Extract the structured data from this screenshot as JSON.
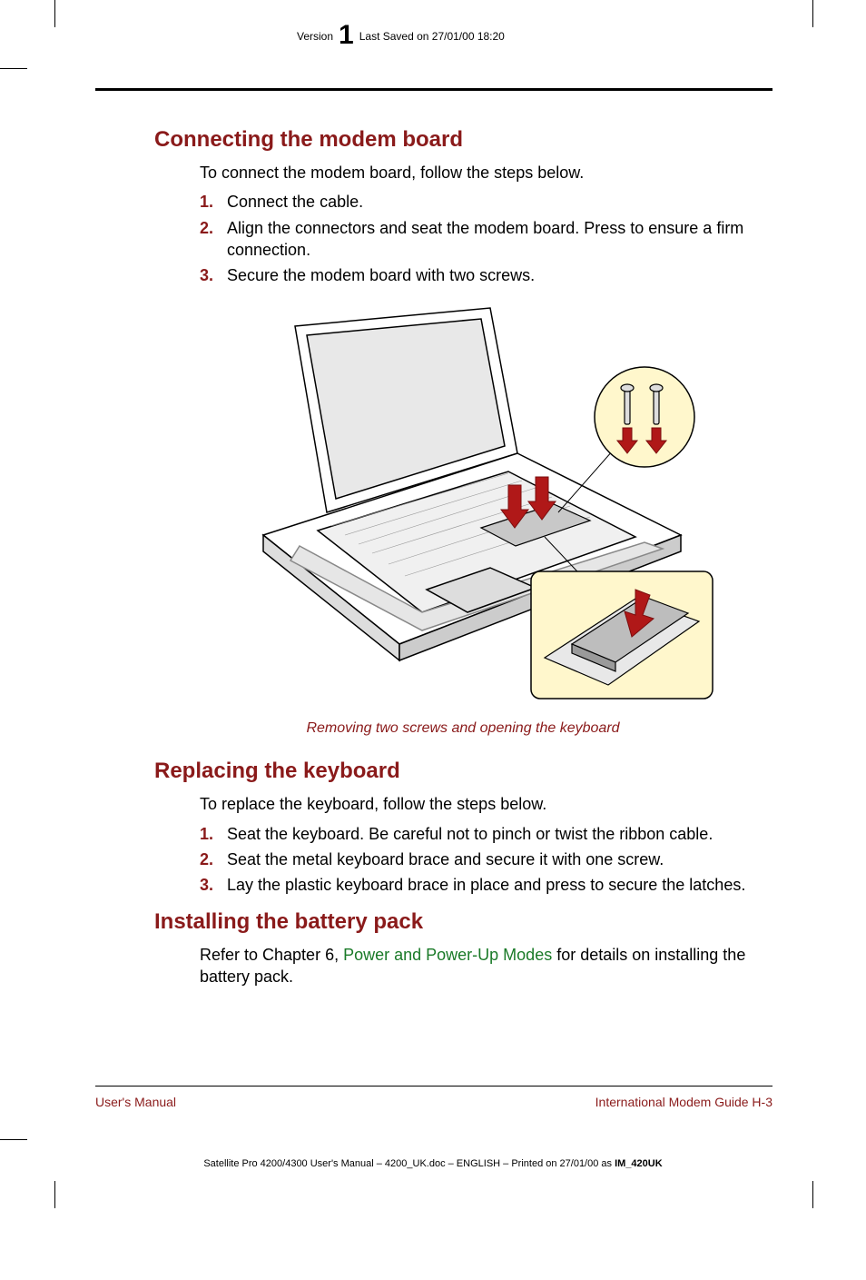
{
  "header": {
    "version_label": "Version",
    "version_num": "1",
    "saved": "Last Saved on 27/01/00 18:20"
  },
  "sections": {
    "s1": {
      "title": "Connecting the modem board",
      "intro": "To connect the modem board, follow the steps below.",
      "steps": {
        "n1": "1.",
        "t1": "Connect the cable.",
        "n2": "2.",
        "t2": "Align the connectors and seat the modem board. Press to ensure a firm connection.",
        "n3": "3.",
        "t3": "Secure the modem board with two screws."
      },
      "caption": "Removing two screws and opening the keyboard"
    },
    "s2": {
      "title": "Replacing the keyboard",
      "intro": "To replace the keyboard, follow the steps below.",
      "steps": {
        "n1": "1.",
        "t1": "Seat the keyboard. Be careful not to pinch or twist the ribbon cable.",
        "n2": "2.",
        "t2": "Seat the metal keyboard brace and secure it with one screw.",
        "n3": "3.",
        "t3": "Lay the plastic keyboard brace in place and press to secure the latches."
      }
    },
    "s3": {
      "title": "Installing the battery pack",
      "para_pre": "Refer to Chapter 6, ",
      "xref": "Power and Power-Up Modes",
      "para_post": " for details on installing the battery pack."
    }
  },
  "footer": {
    "left": "User's Manual",
    "right": "International Modem Guide  H-3"
  },
  "imprint": {
    "text": "Satellite Pro 4200/4300 User's Manual  – 4200_UK.doc – ENGLISH – Printed on 27/01/00 as ",
    "code": "IM_420UK"
  }
}
